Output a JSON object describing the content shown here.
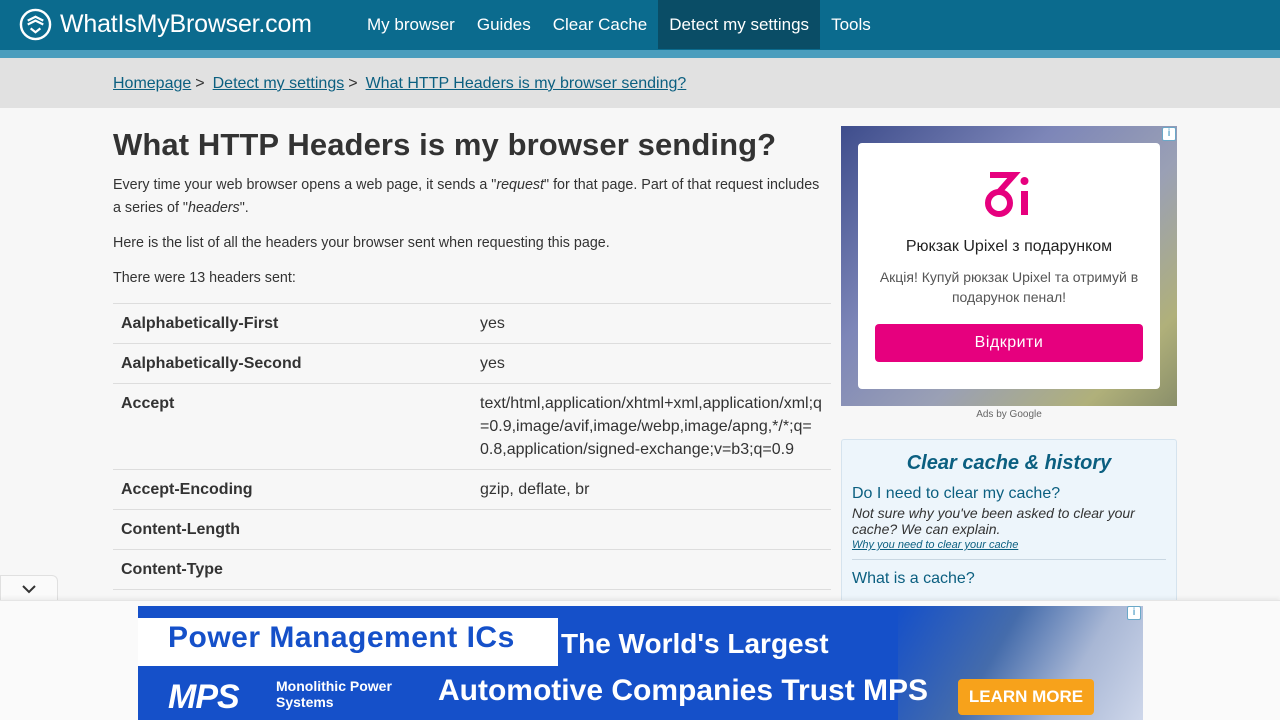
{
  "header": {
    "site_name": "WhatIsMyBrowser.com",
    "nav": [
      "My browser",
      "Guides",
      "Clear Cache",
      "Detect my settings",
      "Tools"
    ],
    "active_nav": "Detect my settings"
  },
  "breadcrumb": {
    "items": [
      "Homepage",
      "Detect my settings",
      "What HTTP Headers is my browser sending?"
    ],
    "separator": ">"
  },
  "main": {
    "title": "What HTTP Headers is my browser sending?",
    "intro_pre": "Every time your web browser opens a web page, it sends a \"",
    "intro_em1": "request",
    "intro_mid": "\" for that page. Part of that request includes a series of \"",
    "intro_em2": "headers",
    "intro_post": "\".",
    "list_text": "Here is the list of all the headers your browser sent when requesting this page.",
    "count_text": "There were 13 headers sent:",
    "headers": [
      {
        "name": "Aalphabetically-First",
        "value": "yes"
      },
      {
        "name": "Aalphabetically-Second",
        "value": "yes"
      },
      {
        "name": "Accept",
        "value": "text/html,application/xhtml+xml,application/xml;q=0.9,image/avif,image/webp,image/apng,*/*;q=0.8,application/signed-exchange;v=b3;q=0.9"
      },
      {
        "name": "Accept-Encoding",
        "value": "gzip, deflate, br"
      },
      {
        "name": "Content-Length",
        "value": ""
      },
      {
        "name": "Content-Type",
        "value": ""
      }
    ]
  },
  "ad": {
    "title": "Рюкзак Upixel з подарунком",
    "description": "Акція! Купуй рюкзак Upixel та отримуй в подарунок пенал!",
    "button": "Відкрити",
    "info_icon": "info-icon",
    "ads_by": "Ads by Google",
    "brand_color": "#e6007e"
  },
  "sidebar": {
    "title": "Clear cache & history",
    "items": [
      {
        "question": "Do I need to clear my cache?",
        "answer": "Not sure why you've been asked to clear your cache? We can explain.",
        "link": "Why you need to clear your cache"
      },
      {
        "question": "What is a cache?",
        "answer": "",
        "link": ""
      }
    ]
  },
  "banner": {
    "headline": "Power Management ICs",
    "tagline": "The World's Largest",
    "brand": "MPS",
    "brand_sub": "Monolithic Power Systems",
    "claim": "Automotive Companies Trust MPS",
    "cta": "LEARN MORE",
    "toggle_icon": "chevron-down-icon"
  },
  "colors": {
    "header_bg": "#0b6b8e",
    "active_nav_bg": "#0a4d66",
    "link": "#0b5f80",
    "banner_blue": "#1550c9",
    "cta_orange": "#f7a21b"
  }
}
